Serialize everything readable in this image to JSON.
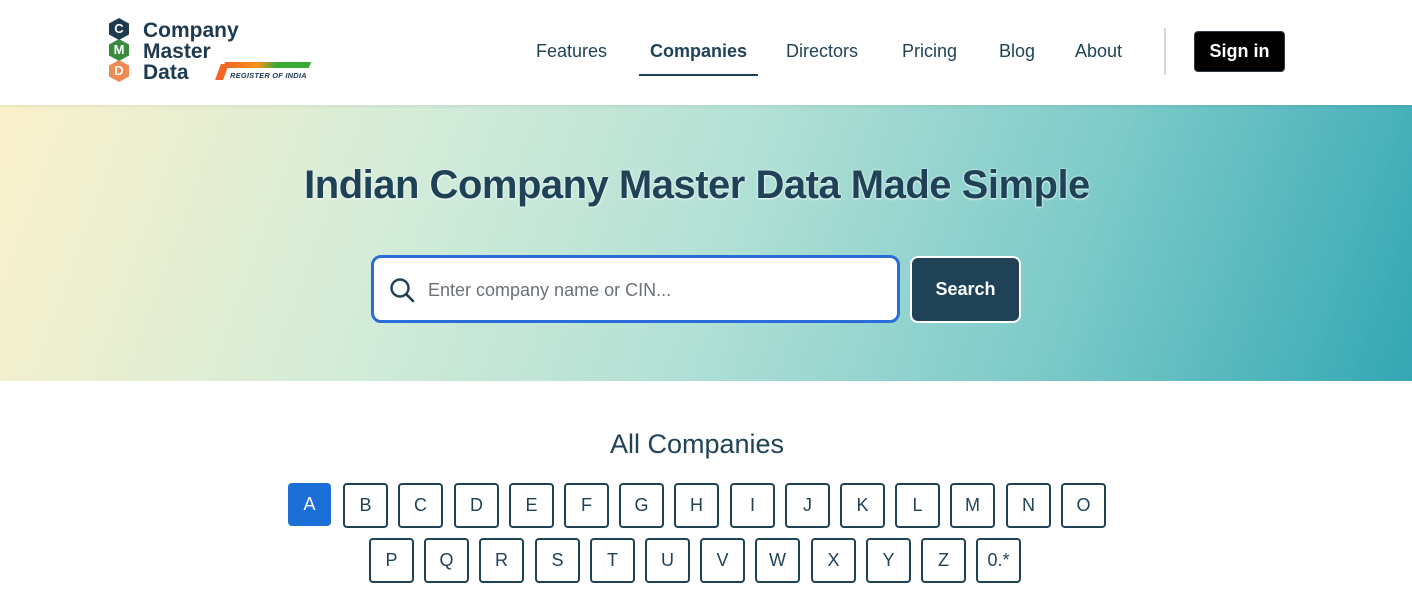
{
  "brand": {
    "badges": [
      "C",
      "M",
      "D"
    ],
    "badge_colors": [
      "#1e3a50",
      "#3a8a3f",
      "#ef8a52"
    ],
    "name_lines": [
      "Company",
      "Master",
      "Data"
    ],
    "tagline": "REGISTER OF INDIA"
  },
  "nav": {
    "items": [
      {
        "label": "Features",
        "active": false
      },
      {
        "label": "Companies",
        "active": true
      },
      {
        "label": "Directors",
        "active": false
      },
      {
        "label": "Pricing",
        "active": false
      },
      {
        "label": "Blog",
        "active": false
      },
      {
        "label": "About",
        "active": false
      }
    ],
    "signin_label": "Sign in"
  },
  "hero": {
    "title": "Indian Company Master Data Made Simple",
    "search_placeholder": "Enter company name or CIN...",
    "search_value": "",
    "search_button": "Search"
  },
  "companies": {
    "title": "All Companies",
    "selected": "A",
    "letters_row1": [
      "A",
      "B",
      "C",
      "D",
      "E",
      "F",
      "G",
      "H",
      "I",
      "J",
      "K",
      "L",
      "M",
      "N",
      "O"
    ],
    "letters_row2": [
      "P",
      "Q",
      "R",
      "S",
      "T",
      "U",
      "V",
      "W",
      "X",
      "Y",
      "Z",
      "0.*"
    ]
  },
  "colors": {
    "primary": "#1f4257",
    "accent_blue": "#1c6fd6",
    "search_border": "#2a6cd8"
  }
}
